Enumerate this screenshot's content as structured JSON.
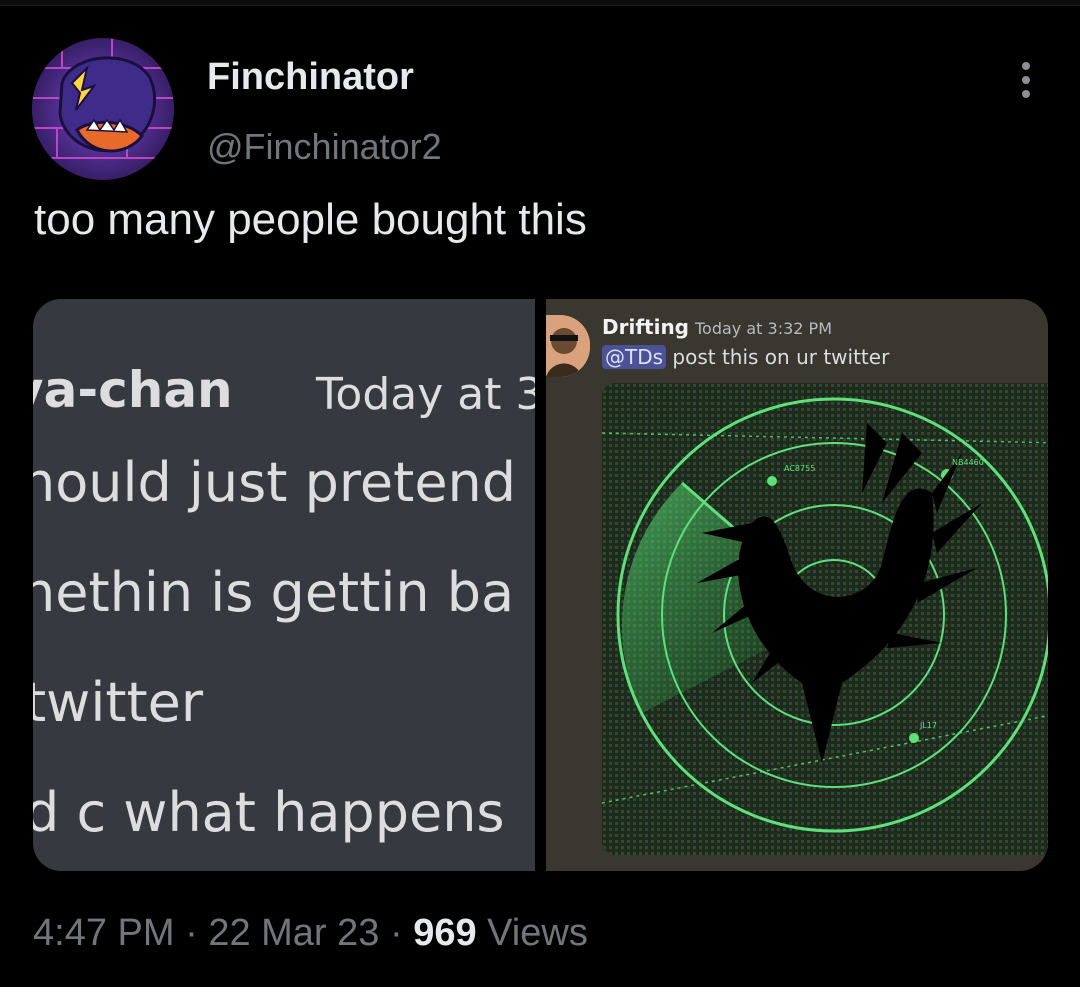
{
  "tweet": {
    "display_name": "Finchinator",
    "handle": "@Finchinator2",
    "text": "too many people bought this",
    "time": "4:47 PM",
    "sep1": " · ",
    "date": "22 Mar 23",
    "sep2": " · ",
    "views_count": "969",
    "views_label": " Views"
  },
  "left_screenshot": {
    "username": "ya-chan",
    "timestamp": "Today at 3",
    "lines": [
      "hould just pretend",
      "nethin is gettin ba",
      "twitter",
      "d c what happens"
    ]
  },
  "right_screenshot": {
    "username": "Drifting",
    "timestamp": "Today at 3:32 PM",
    "mention": "@TDs",
    "message": " post this on ur twitter",
    "radar_labels": [
      "AC8755",
      "NB4460",
      "JL17"
    ]
  },
  "colors": {
    "background": "#000000",
    "text_primary": "#e7e9ea",
    "text_secondary": "#71767b",
    "discord_bg": "#36393f",
    "discord_username": "#7ec4e8",
    "radar_green": "#4cd964"
  }
}
